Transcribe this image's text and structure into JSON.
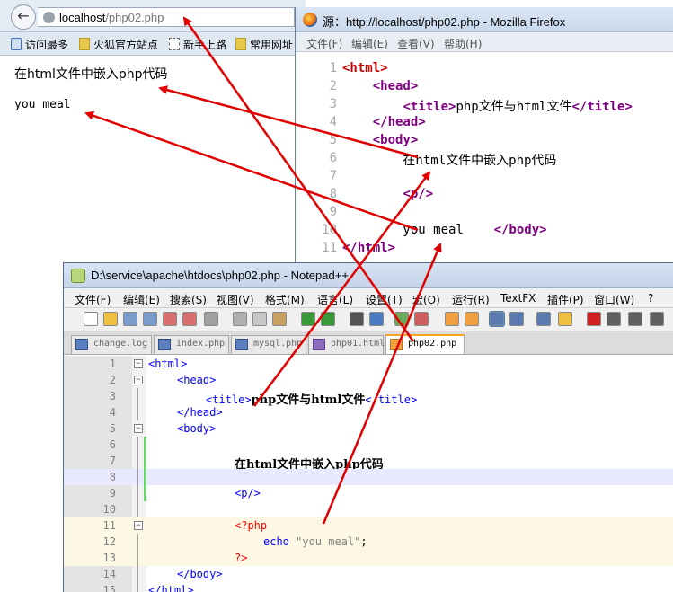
{
  "browser": {
    "url_host": "localhost",
    "url_path": "/php02.php",
    "bookmarks": [
      "访问最多",
      "火狐官方站点",
      "新手上路",
      "常用网址"
    ],
    "page_heading": "在html文件中嵌入php代码",
    "page_text": "you meal"
  },
  "source_window": {
    "title": "源：http://localhost/php02.php - Mozilla Firefox",
    "menu": [
      "文件(F)",
      "编辑(E)",
      "查看(V)",
      "帮助(H)"
    ],
    "lines": [
      {
        "n": "1",
        "text": "<html>"
      },
      {
        "n": "2",
        "text": "    <head>"
      },
      {
        "n": "3",
        "text": "        <title>php文件与html文件</title>"
      },
      {
        "n": "4",
        "text": "    </head>"
      },
      {
        "n": "5",
        "text": "    <body>"
      },
      {
        "n": "6",
        "text": "        在html文件中嵌入php代码"
      },
      {
        "n": "7",
        "text": ""
      },
      {
        "n": "8",
        "text": "        <p/>"
      },
      {
        "n": "9",
        "text": ""
      },
      {
        "n": "10",
        "text": "        you meal    </body>"
      },
      {
        "n": "11",
        "text": "</html>"
      }
    ]
  },
  "npp": {
    "title": "D:\\service\\apache\\htdocs\\php02.php - Notepad++",
    "menu": [
      "文件(F)",
      "编辑(E)",
      "搜索(S)",
      "视图(V)",
      "格式(M)",
      "语言(L)",
      "设置(T)",
      "宏(O)",
      "运行(R)",
      "TextFX",
      "插件(P)",
      "窗口(W)",
      "?"
    ],
    "tabs": [
      "change.log",
      "index.php",
      "mysql.php",
      "php01.html",
      "php02.php"
    ],
    "active_tab": "php02.php",
    "lines": [
      {
        "n": "1",
        "fold": "minus",
        "indent": 0,
        "parts": [
          [
            "n-tag",
            "<html>"
          ]
        ]
      },
      {
        "n": "2",
        "fold": "minus",
        "indent": 1,
        "parts": [
          [
            "n-tag",
            "<head>"
          ]
        ]
      },
      {
        "n": "3",
        "fold": "",
        "indent": 2,
        "parts": [
          [
            "n-tag",
            "<title>"
          ],
          [
            "n-plain",
            "php文件与html文件"
          ],
          [
            "n-tag",
            "</title>"
          ]
        ]
      },
      {
        "n": "4",
        "fold": "",
        "indent": 1,
        "parts": [
          [
            "n-tag",
            "</head>"
          ]
        ]
      },
      {
        "n": "5",
        "fold": "minus",
        "indent": 1,
        "parts": [
          [
            "n-tag",
            "<body>"
          ]
        ]
      },
      {
        "n": "6",
        "fold": "",
        "indent": 0,
        "parts": []
      },
      {
        "n": "7",
        "fold": "",
        "indent": 3,
        "parts": [
          [
            "n-plain",
            "在html文件中嵌入php代码"
          ]
        ]
      },
      {
        "n": "8",
        "fold": "",
        "indent": 0,
        "parts": [],
        "hl": true
      },
      {
        "n": "9",
        "fold": "",
        "indent": 3,
        "parts": [
          [
            "n-tag",
            "<p/>"
          ]
        ]
      },
      {
        "n": "10",
        "fold": "",
        "indent": 0,
        "parts": []
      },
      {
        "n": "11",
        "fold": "minus",
        "indent": 3,
        "parts": [
          [
            "n-php",
            "<?php"
          ]
        ],
        "php": true
      },
      {
        "n": "12",
        "fold": "",
        "indent": 4,
        "parts": [
          [
            "n-kw",
            "echo "
          ],
          [
            "n-str",
            "\"you meal\""
          ],
          [
            "n-punc",
            ";"
          ]
        ],
        "php": true
      },
      {
        "n": "13",
        "fold": "",
        "indent": 3,
        "parts": [
          [
            "n-php",
            "?>"
          ]
        ],
        "php": true
      },
      {
        "n": "14",
        "fold": "",
        "indent": 1,
        "parts": [
          [
            "n-tag",
            "</body>"
          ]
        ]
      },
      {
        "n": "15",
        "fold": "",
        "indent": 0,
        "parts": [
          [
            "n-tag",
            "</html>"
          ]
        ]
      }
    ]
  },
  "colors": {
    "arrow": "#e00000",
    "source_tag": "#800080",
    "npp_tag": "#0000ff",
    "php_delim": "#ff0000"
  }
}
